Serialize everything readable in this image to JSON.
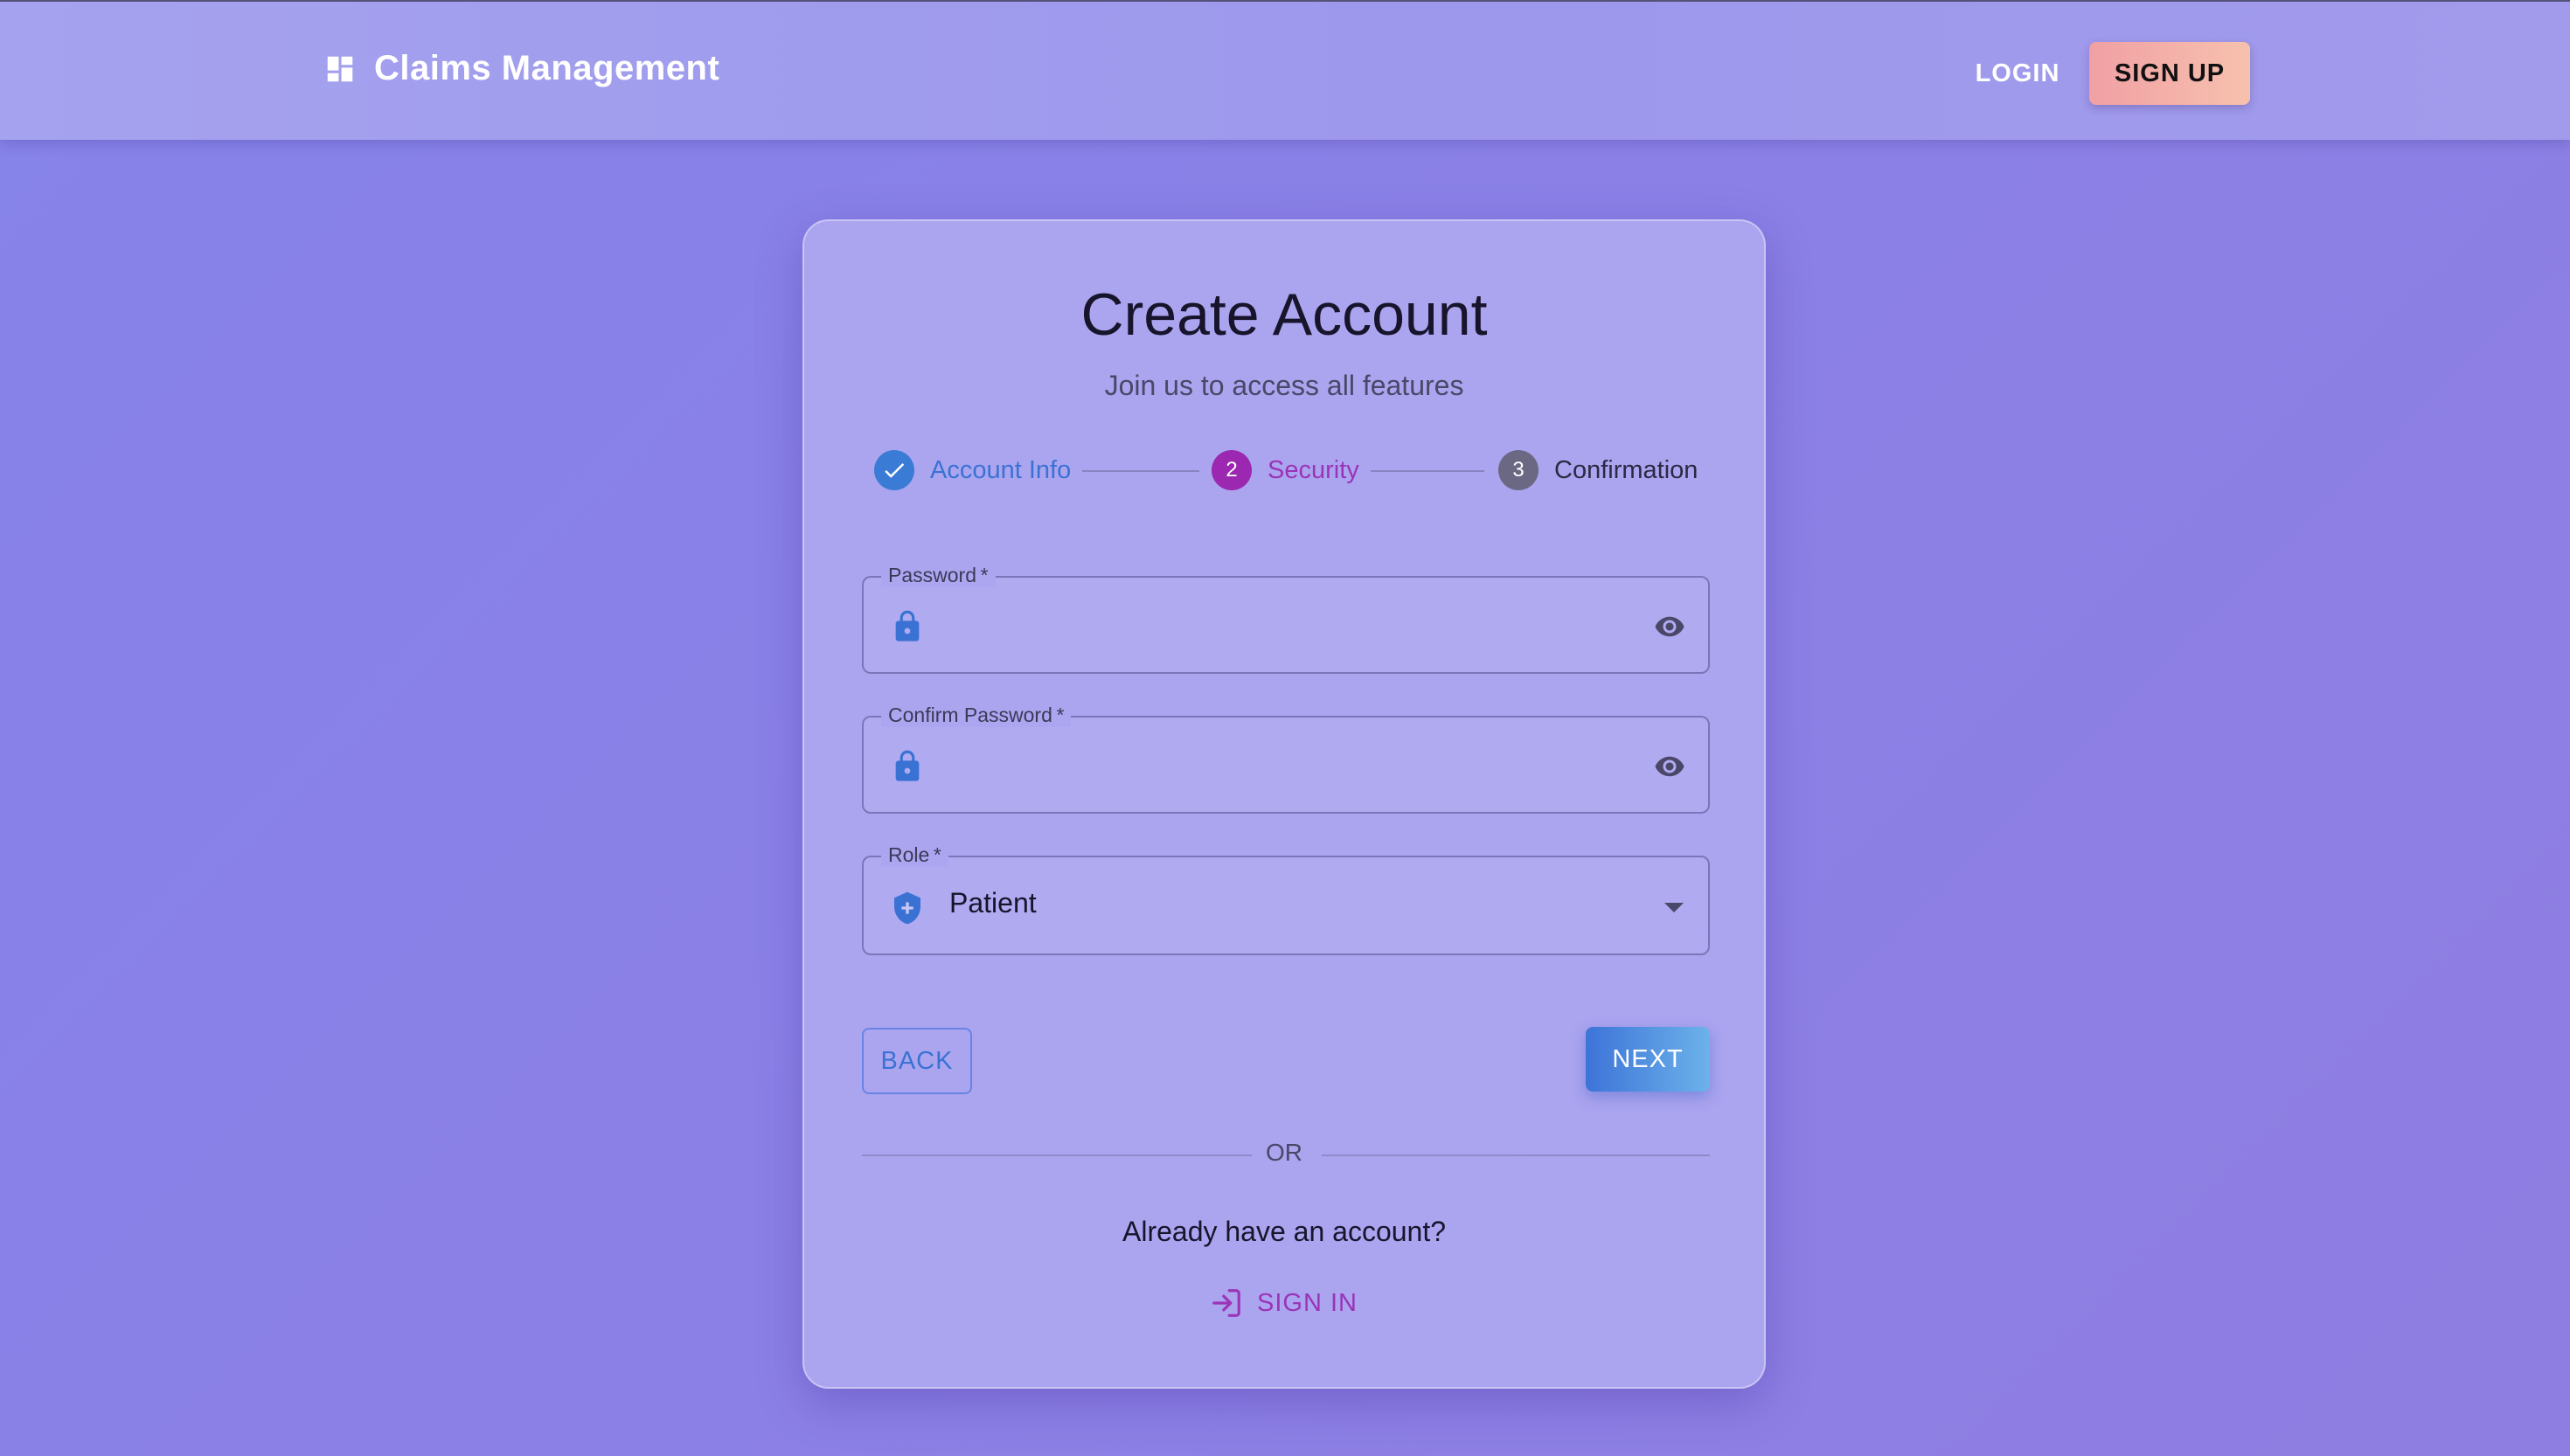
{
  "app": {
    "title": "Claims Management",
    "brand_icon": "dashboard-icon"
  },
  "nav": {
    "login_label": "LOGIN",
    "signup_label": "SIGN UP"
  },
  "card": {
    "title": "Create Account",
    "subtitle": "Join us to access all features"
  },
  "steps": [
    {
      "label": "Account Info",
      "state": "completed",
      "icon": "check-icon",
      "color": "#3a7bd5"
    },
    {
      "label": "Security",
      "state": "active",
      "number": "2",
      "color": "#9c27b0"
    },
    {
      "label": "Confirmation",
      "state": "pending",
      "number": "3",
      "color": "#6b6884"
    }
  ],
  "form": {
    "password": {
      "label": "Password",
      "required_mark": "*",
      "value": "",
      "icon": "lock-icon",
      "toggle_icon": "eye-icon"
    },
    "confirm_password": {
      "label": "Confirm Password",
      "required_mark": "*",
      "value": "",
      "icon": "lock-icon",
      "toggle_icon": "eye-icon"
    },
    "role": {
      "label": "Role",
      "required_mark": "*",
      "value": "Patient",
      "icon": "shield-plus-icon"
    }
  },
  "actions": {
    "back_label": "BACK",
    "next_label": "NEXT"
  },
  "footer": {
    "or_text": "OR",
    "already_text": "Already have an account?",
    "signin_label": "SIGN IN",
    "signin_icon": "login-icon"
  },
  "colors": {
    "primary": "#3a7bd5",
    "secondary": "#9c27b0",
    "signup_gradient_start": "#f0a0a4",
    "signup_gradient_end": "#f7c1ae",
    "background": "#8a82e6"
  }
}
